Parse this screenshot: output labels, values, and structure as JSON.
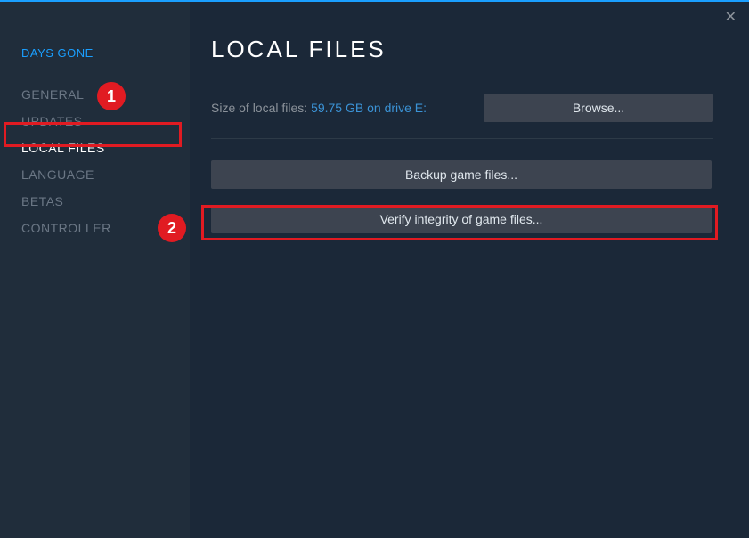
{
  "game_title": "DAYS GONE",
  "sidebar": {
    "items": [
      {
        "label": "GENERAL"
      },
      {
        "label": "UPDATES"
      },
      {
        "label": "LOCAL FILES"
      },
      {
        "label": "LANGUAGE"
      },
      {
        "label": "BETAS"
      },
      {
        "label": "CONTROLLER"
      }
    ]
  },
  "main": {
    "title": "LOCAL FILES",
    "size_label": "Size of local files: ",
    "size_value": "59.75 GB on drive E:",
    "browse_label": "Browse...",
    "backup_label": "Backup game files...",
    "verify_label": "Verify integrity of game files..."
  },
  "annotations": {
    "badge1": "1",
    "badge2": "2"
  }
}
